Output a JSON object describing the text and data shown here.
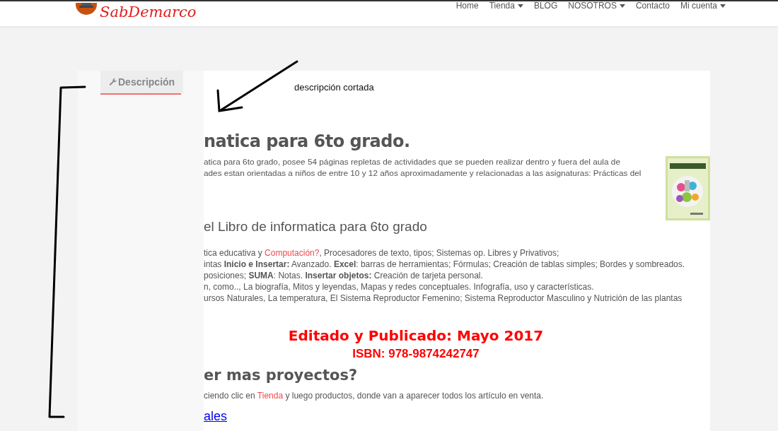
{
  "header": {
    "logo_text": "SabDemarco",
    "nav": [
      {
        "label": "Home",
        "dropdown": false
      },
      {
        "label": "Tienda",
        "dropdown": true
      },
      {
        "label": "BLOG",
        "dropdown": false
      },
      {
        "label": "NOSOTROS",
        "dropdown": true
      },
      {
        "label": "Contacto",
        "dropdown": false
      },
      {
        "label": "Mi cuenta",
        "dropdown": true
      }
    ]
  },
  "tabs": [
    {
      "label": "Descripción",
      "selected": true
    }
  ],
  "annotation": {
    "text": "descripción cortada"
  },
  "content": {
    "title": "natica para 6to grado.",
    "intro": [
      "atica para 6to grado, posee 54 páginas repletas de actividades que se pueden realizar dentro y fuera del aula de",
      "ades estan orientadas a niños de entre 10 y 12 años aproximadamente y relacionadas a las asignaturas: Prácticas del"
    ],
    "cover": {
      "kind": "picture"
    },
    "subtitle": "el Libro de informatica para 6to grado",
    "list": [
      [
        {
          "kind": "text",
          "text": "tica educativa y "
        },
        {
          "kind": "link",
          "text": "Computación?"
        },
        {
          "kind": "text",
          "text": ", Procesadores de texto, tipos; Sistemas op. Libres y Privativos;"
        }
      ],
      [
        {
          "kind": "text",
          "text": "intas **Inicio e Insertar:** Avanzado. **Excel**: barras de herramientas; Fórmulas; Creación de tablas simples; Bordes y sombreados."
        }
      ],
      [
        {
          "kind": "text",
          "text": "posiciones; **SUMA**: Notas. **Insertar objetos:** Creación de tarjeta personal."
        }
      ],
      [
        {
          "kind": "text",
          "text": "n, como.., La biografía, Mitos y leyendas, Mapas y redes conceptuales. Infografía, uso y características."
        }
      ],
      [
        {
          "kind": "text",
          "text": "ursos Naturales, La temperatura, El Sistema Reproductor Femenino; Sistema Reproductor Masculino y Nutrición de las plantas"
        }
      ]
    ],
    "published": "Editado y Publicado: Mayo 2017",
    "isbn": "ISBN: 978-9874242747",
    "more_title": "er mas proyectos?",
    "more_text": [
      {
        "kind": "text",
        "text": "ciendo clic en  "
      },
      {
        "kind": "link",
        "text": "Tienda"
      },
      {
        "kind": "text",
        "text": " y luego  productos, donde van a aparecer todos los artículo en venta."
      }
    ],
    "bottom_link": "ales"
  }
}
